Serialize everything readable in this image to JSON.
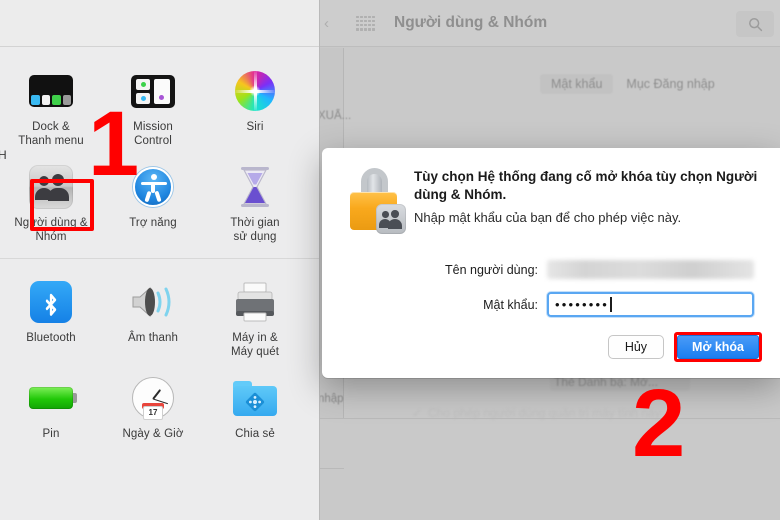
{
  "prefs_panel": {
    "edge_fragment_left": "H",
    "edge_fragment_bottom": "nhập",
    "sections": [
      {
        "rows": [
          [
            {
              "icon": "dock-icon",
              "label": "Dock &\nThanh menu"
            },
            {
              "icon": "mission-control-icon",
              "label": "Mission\nControl"
            },
            {
              "icon": "siri-icon",
              "label": "Siri"
            }
          ],
          [
            {
              "icon": "users-groups-icon",
              "label": "Người dùng &\nNhóm"
            },
            {
              "icon": "accessibility-icon",
              "label": "Trợ năng"
            },
            {
              "icon": "screen-time-icon",
              "label": "Thời gian\nsử dụng"
            }
          ]
        ]
      },
      {
        "rows": [
          [
            {
              "icon": "bluetooth-icon",
              "label": "Bluetooth"
            },
            {
              "icon": "sound-icon",
              "label": "Âm thanh"
            },
            {
              "icon": "printers-scanners-icon",
              "label": "Máy in &\nMáy quét"
            }
          ],
          [
            {
              "icon": "battery-icon",
              "label": "Pin"
            },
            {
              "icon": "date-time-icon",
              "label": "Ngày & Giờ"
            },
            {
              "icon": "sharing-icon",
              "label": "Chia sẻ"
            }
          ]
        ]
      }
    ]
  },
  "background_window": {
    "title": "Người dùng & Nhóm",
    "grid_icon": "app-grid-icon",
    "search_icon": "search-icon",
    "back_chevron": "‹",
    "sidebar_label": "XUẤ...",
    "sidebar_label_2": "nhập",
    "tabs": [
      {
        "label": "Mật khẩu",
        "selected": true
      },
      {
        "label": "Mục Đăng nhập",
        "selected": false
      }
    ],
    "contact_card_line": "Thẻ Danh bạ:   Mở...",
    "admin_checkbox_line": "Cho phép người dùng quản trị máy tính này",
    "checkmark": "✓"
  },
  "dialog": {
    "lock_icon": "lock-users-icon",
    "title": "Tùy chọn Hệ thống đang cố mở khóa tùy chọn Người dùng & Nhóm.",
    "subtitle": "Nhập mật khẩu của bạn để cho phép việc này.",
    "username_label": "Tên người dùng:",
    "username_value": "",
    "password_label": "Mật khẩu:",
    "password_value": "••••••••",
    "cancel_label": "Hủy",
    "unlock_label": "Mở khóa"
  },
  "annotations": [
    {
      "name": "step-1",
      "text": "1"
    },
    {
      "name": "step-2",
      "text": "2"
    }
  ],
  "colors": {
    "annotation_red": "#ff0000",
    "primary_button_blue": "#1a7ef0",
    "field_focus_blue": "#5aa7f2",
    "lock_orange": "#f9a91d"
  }
}
